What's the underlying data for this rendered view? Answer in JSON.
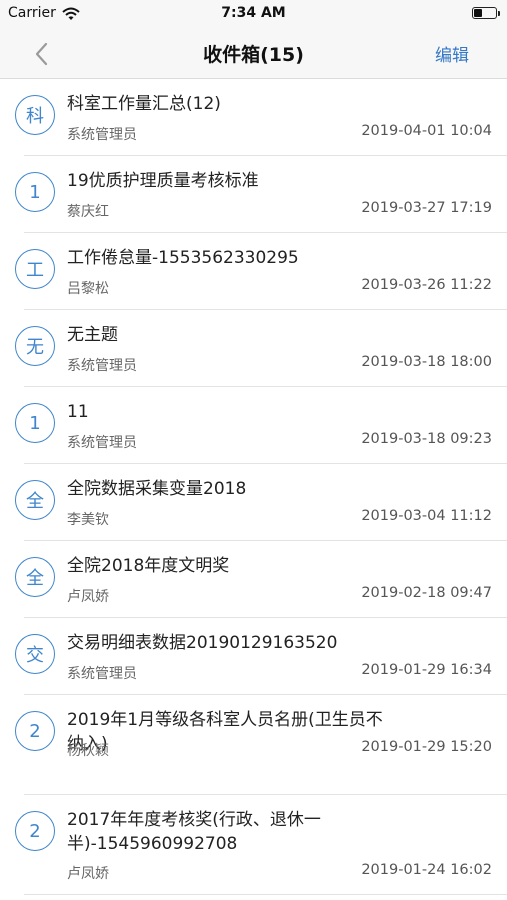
{
  "status_bar": {
    "carrier": "Carrier",
    "time": "7:34 AM"
  },
  "nav": {
    "title": "收件箱(15)",
    "edit_label": "编辑"
  },
  "accent_color": "#3f86cc",
  "emails": [
    {
      "avatar": "科",
      "subject": "科室工作量汇总(12)",
      "sender": "系统管理员",
      "date": "2019-04-01 10:04"
    },
    {
      "avatar": "1",
      "subject": "19优质护理质量考核标准",
      "sender": "蔡庆红",
      "date": "2019-03-27 17:19"
    },
    {
      "avatar": "工",
      "subject": "工作倦怠量-1553562330295",
      "sender": "吕黎松",
      "date": "2019-03-26 11:22"
    },
    {
      "avatar": "无",
      "subject": "无主题",
      "sender": "系统管理员",
      "date": "2019-03-18 18:00"
    },
    {
      "avatar": "1",
      "subject": "11",
      "sender": "系统管理员",
      "date": "2019-03-18 09:23"
    },
    {
      "avatar": "全",
      "subject": "全院数据采集变量2018",
      "sender": "李美钦",
      "date": "2019-03-04 11:12"
    },
    {
      "avatar": "全",
      "subject": "全院2018年度文明奖",
      "sender": "卢凤娇",
      "date": "2019-02-18 09:47"
    },
    {
      "avatar": "交",
      "subject": "交易明细表数据20190129163520",
      "sender": "系统管理员",
      "date": "2019-01-29 16:34"
    },
    {
      "avatar": "2",
      "subject": "2019年1月等级各科室人员名册(卫生员不纳入)",
      "sender": "杨秋颖",
      "date": "2019-01-29 15:20"
    },
    {
      "avatar": "2",
      "subject": "2017年年度考核奖(行政、退休一半)-1545960992708",
      "sender": "卢凤娇",
      "date": "2019-01-24 16:02"
    }
  ]
}
